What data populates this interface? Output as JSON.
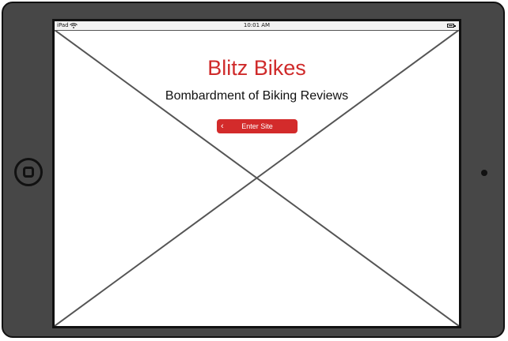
{
  "statusbar": {
    "device_label": "iPad",
    "time": "10:01 AM",
    "wifi_icon": "wifi-icon",
    "battery_icon": "battery-icon"
  },
  "page": {
    "title": "Blitz Bikes",
    "subtitle": "Bombardment of Biking Reviews",
    "enter_button_label": "Enter Site",
    "enter_button_icon": "chevron-left-icon"
  },
  "colors": {
    "accent": "#d32b2b",
    "title": "#cf2a2a",
    "device_frame": "#474747"
  }
}
